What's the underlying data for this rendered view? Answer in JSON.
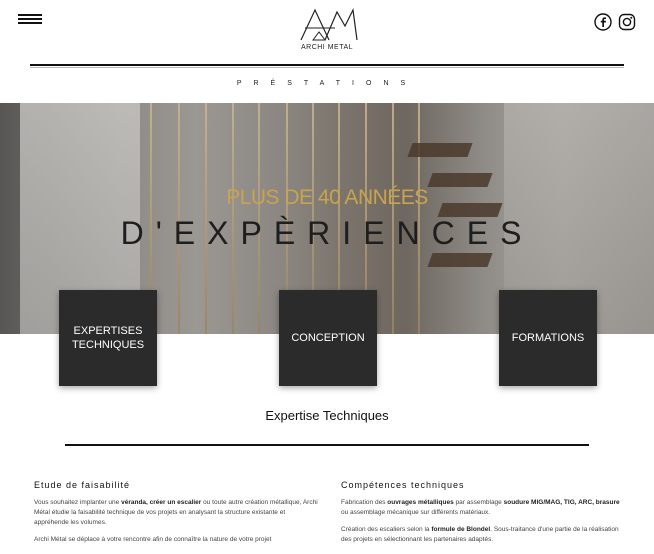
{
  "header": {
    "logo_text": "ARCHI METAL",
    "social": [
      {
        "icon": "facebook-icon"
      },
      {
        "icon": "instagram-icon"
      }
    ]
  },
  "nav": {
    "label": "PRÉSTATIONS"
  },
  "hero": {
    "subtitle": "PLUS DE 40 ANNÉES",
    "title": "D'EXPÈRIENCES"
  },
  "cards": [
    {
      "label": "EXPERTISES TECHNIQUES"
    },
    {
      "label": "CONCEPTION"
    },
    {
      "label": "FORMATIONS"
    }
  ],
  "section": {
    "title": "Expertise Techniques"
  },
  "columns": {
    "left": {
      "heading": "Etude de faisabilité",
      "p1_a": "Vous souhaitez implanter une ",
      "p1_b": "véranda, créer un escalier",
      "p1_c": " ou toute autre création métallique, Archi Métal étudie la faisabilité technique de vos projets en analysant la structure existante et appréhende les volumes.",
      "p2": "Archi Métal se déplace à votre rencontre afin de connaître la nature de votre projet"
    },
    "right": {
      "heading": "Compétences techniques",
      "p1_a": "Fabrication des ",
      "p1_b": "ouvrages métalliques",
      "p1_c": " par assemblage ",
      "p1_d": "soudure MIG/MAG, TIG, ARC, brasure",
      "p1_e": " ou assemblage mécanique sur différents matériaux.",
      "p2_a": "Création des escaliers selon la ",
      "p2_b": "formule de Blondel",
      "p2_c": ". Sous-traitance d'une partie de la réalisation des projets en sélectionnant les partenaires adaptés."
    }
  },
  "colors": {
    "accent": "#c9a44d",
    "card_bg": "#2b2b2b"
  }
}
